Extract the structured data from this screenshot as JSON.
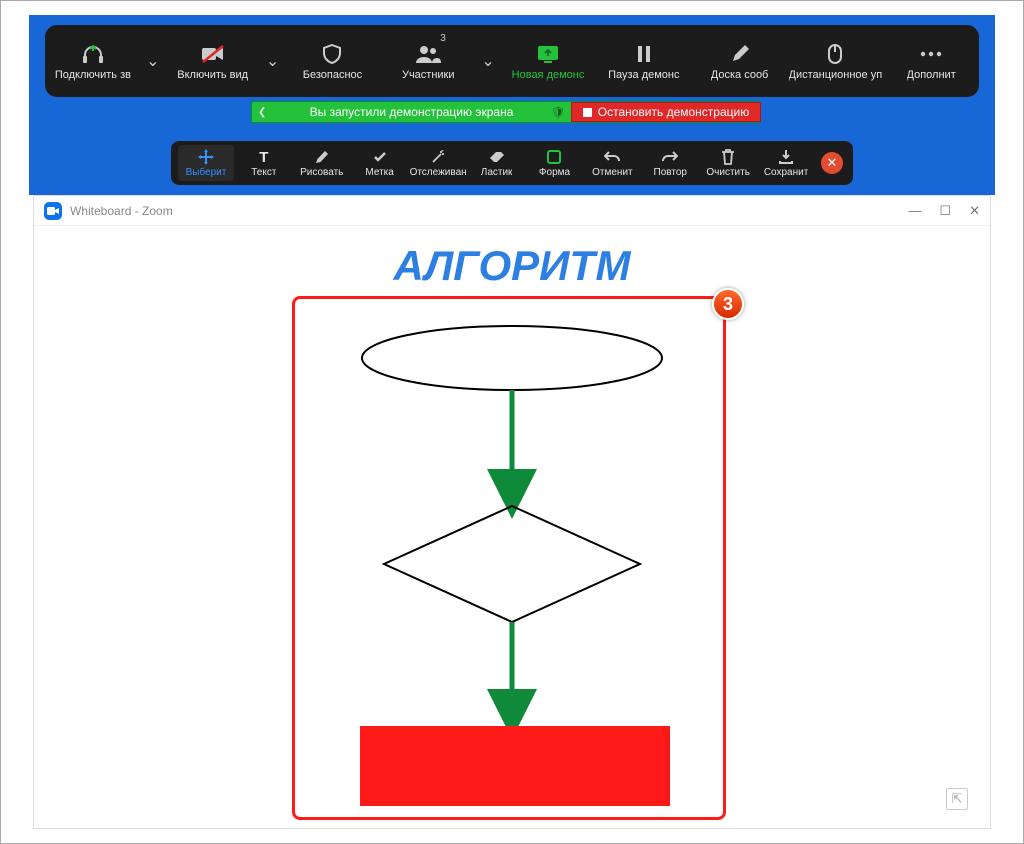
{
  "colors": {
    "desktop_blue": "#1767d6",
    "accent_green": "#24c23b",
    "danger_red": "#e02828"
  },
  "meeting_toolbar": {
    "items": [
      {
        "id": "audio",
        "label": "Подключить зв"
      },
      {
        "id": "video",
        "label": "Включить вид"
      },
      {
        "id": "security",
        "label": "Безопаснос"
      },
      {
        "id": "participants",
        "label": "Участники",
        "badge": "3"
      },
      {
        "id": "share",
        "label": "Новая демонс",
        "green": true
      },
      {
        "id": "pause",
        "label": "Пауза демонс"
      },
      {
        "id": "whiteboard",
        "label": "Доска сооб"
      },
      {
        "id": "remote",
        "label": "Дистанционное уп"
      },
      {
        "id": "more",
        "label": "Дополнит"
      }
    ]
  },
  "share_status": {
    "msg": "Вы запустили демонстрацию экрана",
    "stop": "Остановить демонстрацию"
  },
  "anno_toolbar": {
    "items": [
      {
        "id": "select",
        "label": "Выберит",
        "active": true
      },
      {
        "id": "text",
        "label": "Текст"
      },
      {
        "id": "draw",
        "label": "Рисовать"
      },
      {
        "id": "stamp",
        "label": "Метка"
      },
      {
        "id": "highlight",
        "label": "Отслеживан"
      },
      {
        "id": "eraser",
        "label": "Ластик"
      },
      {
        "id": "shape",
        "label": "Форма"
      },
      {
        "id": "undo",
        "label": "Отменит"
      },
      {
        "id": "redo",
        "label": "Повтор"
      },
      {
        "id": "trash",
        "label": "Очистить"
      },
      {
        "id": "save",
        "label": "Сохранит"
      }
    ]
  },
  "whiteboard": {
    "window_title": "Whiteboard - Zoom",
    "heading": "АЛГОРИТМ",
    "callout_number": "3"
  }
}
